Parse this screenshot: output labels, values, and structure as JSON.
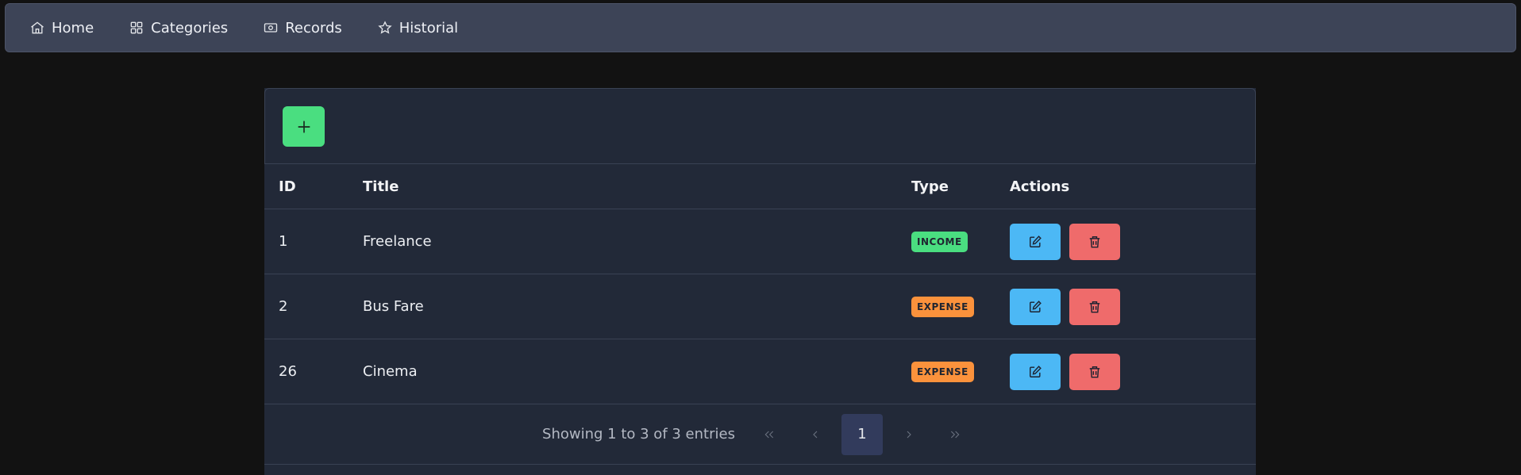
{
  "nav": {
    "items": [
      {
        "label": "Home",
        "icon": "home-icon"
      },
      {
        "label": "Categories",
        "icon": "grid-icon"
      },
      {
        "label": "Records",
        "icon": "money-icon"
      },
      {
        "label": "Historial",
        "icon": "star-icon"
      }
    ]
  },
  "toolbar": {
    "add_icon": "plus-icon"
  },
  "table": {
    "headers": {
      "id": "ID",
      "title": "Title",
      "type": "Type",
      "actions": "Actions"
    },
    "rows": [
      {
        "id": "1",
        "title": "Freelance",
        "type": "INCOME"
      },
      {
        "id": "2",
        "title": "Bus Fare",
        "type": "EXPENSE"
      },
      {
        "id": "26",
        "title": "Cinema",
        "type": "EXPENSE"
      }
    ]
  },
  "pagination": {
    "showing": "Showing 1 to 3 of 3 entries",
    "current_page": "1"
  },
  "colors": {
    "income": "#4ade80",
    "expense": "#fb923c",
    "edit": "#4cb8f5",
    "delete": "#ef6b6b",
    "add": "#4ade80"
  }
}
